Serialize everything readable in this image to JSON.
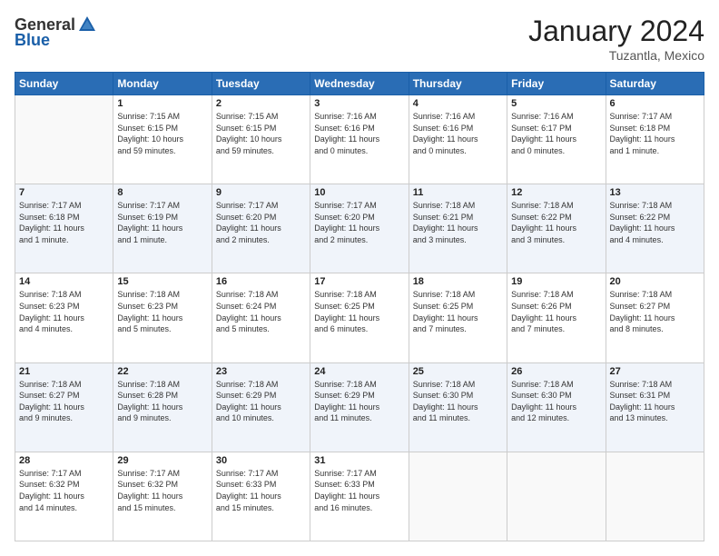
{
  "header": {
    "logo_general": "General",
    "logo_blue": "Blue",
    "month": "January 2024",
    "location": "Tuzantla, Mexico"
  },
  "weekdays": [
    "Sunday",
    "Monday",
    "Tuesday",
    "Wednesday",
    "Thursday",
    "Friday",
    "Saturday"
  ],
  "weeks": [
    [
      {
        "day": "",
        "info": ""
      },
      {
        "day": "1",
        "info": "Sunrise: 7:15 AM\nSunset: 6:15 PM\nDaylight: 10 hours\nand 59 minutes."
      },
      {
        "day": "2",
        "info": "Sunrise: 7:15 AM\nSunset: 6:15 PM\nDaylight: 10 hours\nand 59 minutes."
      },
      {
        "day": "3",
        "info": "Sunrise: 7:16 AM\nSunset: 6:16 PM\nDaylight: 11 hours\nand 0 minutes."
      },
      {
        "day": "4",
        "info": "Sunrise: 7:16 AM\nSunset: 6:16 PM\nDaylight: 11 hours\nand 0 minutes."
      },
      {
        "day": "5",
        "info": "Sunrise: 7:16 AM\nSunset: 6:17 PM\nDaylight: 11 hours\nand 0 minutes."
      },
      {
        "day": "6",
        "info": "Sunrise: 7:17 AM\nSunset: 6:18 PM\nDaylight: 11 hours\nand 1 minute."
      }
    ],
    [
      {
        "day": "7",
        "info": "Sunrise: 7:17 AM\nSunset: 6:18 PM\nDaylight: 11 hours\nand 1 minute."
      },
      {
        "day": "8",
        "info": "Sunrise: 7:17 AM\nSunset: 6:19 PM\nDaylight: 11 hours\nand 1 minute."
      },
      {
        "day": "9",
        "info": "Sunrise: 7:17 AM\nSunset: 6:20 PM\nDaylight: 11 hours\nand 2 minutes."
      },
      {
        "day": "10",
        "info": "Sunrise: 7:17 AM\nSunset: 6:20 PM\nDaylight: 11 hours\nand 2 minutes."
      },
      {
        "day": "11",
        "info": "Sunrise: 7:18 AM\nSunset: 6:21 PM\nDaylight: 11 hours\nand 3 minutes."
      },
      {
        "day": "12",
        "info": "Sunrise: 7:18 AM\nSunset: 6:22 PM\nDaylight: 11 hours\nand 3 minutes."
      },
      {
        "day": "13",
        "info": "Sunrise: 7:18 AM\nSunset: 6:22 PM\nDaylight: 11 hours\nand 4 minutes."
      }
    ],
    [
      {
        "day": "14",
        "info": "Sunrise: 7:18 AM\nSunset: 6:23 PM\nDaylight: 11 hours\nand 4 minutes."
      },
      {
        "day": "15",
        "info": "Sunrise: 7:18 AM\nSunset: 6:23 PM\nDaylight: 11 hours\nand 5 minutes."
      },
      {
        "day": "16",
        "info": "Sunrise: 7:18 AM\nSunset: 6:24 PM\nDaylight: 11 hours\nand 5 minutes."
      },
      {
        "day": "17",
        "info": "Sunrise: 7:18 AM\nSunset: 6:25 PM\nDaylight: 11 hours\nand 6 minutes."
      },
      {
        "day": "18",
        "info": "Sunrise: 7:18 AM\nSunset: 6:25 PM\nDaylight: 11 hours\nand 7 minutes."
      },
      {
        "day": "19",
        "info": "Sunrise: 7:18 AM\nSunset: 6:26 PM\nDaylight: 11 hours\nand 7 minutes."
      },
      {
        "day": "20",
        "info": "Sunrise: 7:18 AM\nSunset: 6:27 PM\nDaylight: 11 hours\nand 8 minutes."
      }
    ],
    [
      {
        "day": "21",
        "info": "Sunrise: 7:18 AM\nSunset: 6:27 PM\nDaylight: 11 hours\nand 9 minutes."
      },
      {
        "day": "22",
        "info": "Sunrise: 7:18 AM\nSunset: 6:28 PM\nDaylight: 11 hours\nand 9 minutes."
      },
      {
        "day": "23",
        "info": "Sunrise: 7:18 AM\nSunset: 6:29 PM\nDaylight: 11 hours\nand 10 minutes."
      },
      {
        "day": "24",
        "info": "Sunrise: 7:18 AM\nSunset: 6:29 PM\nDaylight: 11 hours\nand 11 minutes."
      },
      {
        "day": "25",
        "info": "Sunrise: 7:18 AM\nSunset: 6:30 PM\nDaylight: 11 hours\nand 11 minutes."
      },
      {
        "day": "26",
        "info": "Sunrise: 7:18 AM\nSunset: 6:30 PM\nDaylight: 11 hours\nand 12 minutes."
      },
      {
        "day": "27",
        "info": "Sunrise: 7:18 AM\nSunset: 6:31 PM\nDaylight: 11 hours\nand 13 minutes."
      }
    ],
    [
      {
        "day": "28",
        "info": "Sunrise: 7:17 AM\nSunset: 6:32 PM\nDaylight: 11 hours\nand 14 minutes."
      },
      {
        "day": "29",
        "info": "Sunrise: 7:17 AM\nSunset: 6:32 PM\nDaylight: 11 hours\nand 15 minutes."
      },
      {
        "day": "30",
        "info": "Sunrise: 7:17 AM\nSunset: 6:33 PM\nDaylight: 11 hours\nand 15 minutes."
      },
      {
        "day": "31",
        "info": "Sunrise: 7:17 AM\nSunset: 6:33 PM\nDaylight: 11 hours\nand 16 minutes."
      },
      {
        "day": "",
        "info": ""
      },
      {
        "day": "",
        "info": ""
      },
      {
        "day": "",
        "info": ""
      }
    ]
  ]
}
